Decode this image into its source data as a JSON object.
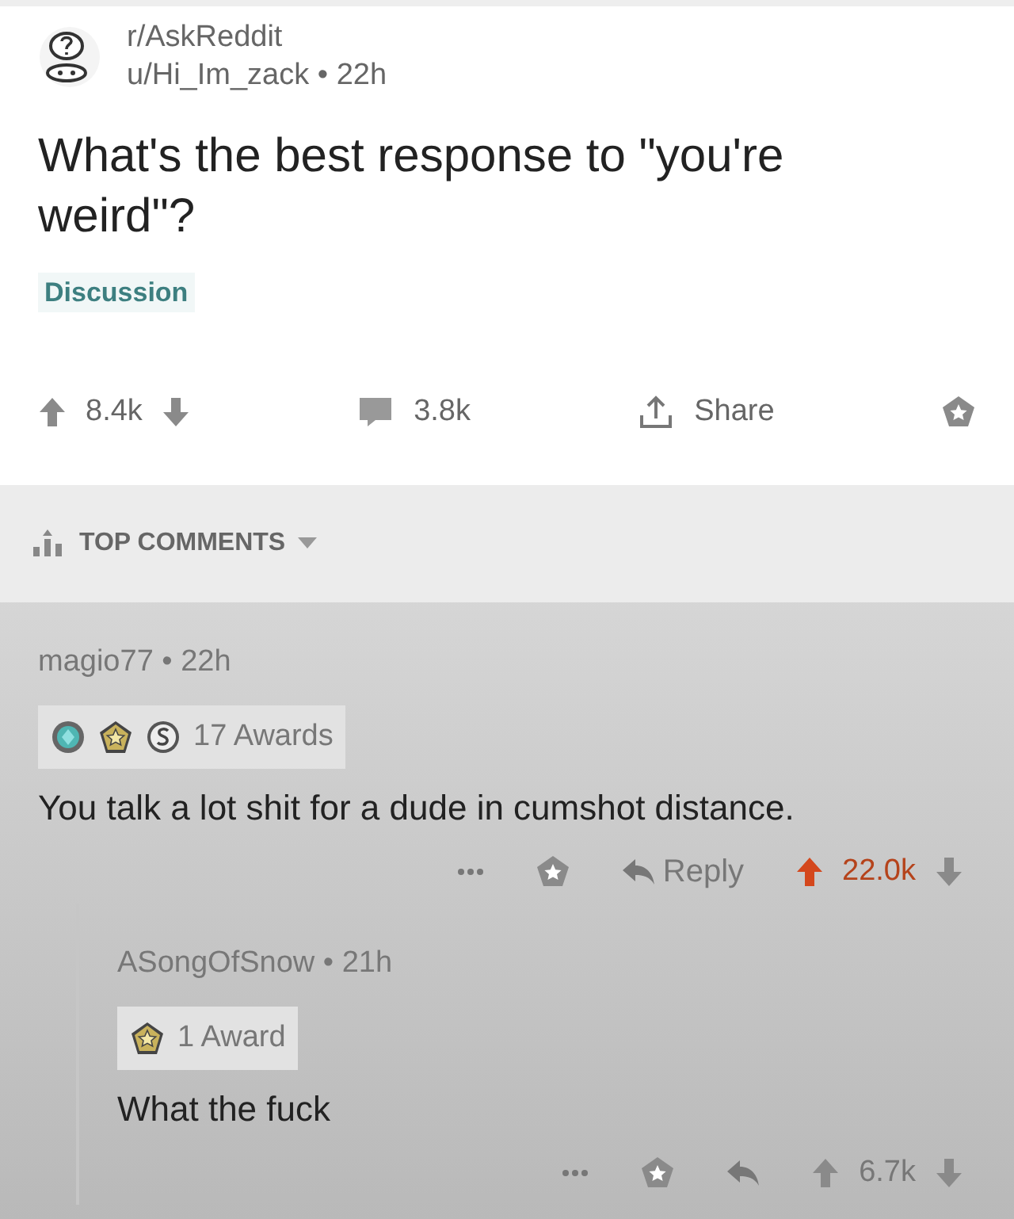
{
  "post": {
    "subreddit": "r/AskReddit",
    "author": "u/Hi_Im_zack",
    "separator": "•",
    "age": "22h",
    "title": "What's the best response to \"you're weird\"?",
    "flair": "Discussion",
    "score": "8.4k",
    "comments": "3.8k",
    "share": "Share"
  },
  "sort": {
    "label": "TOP COMMENTS"
  },
  "comments": [
    {
      "author": "magio77",
      "separator": "•",
      "age": "22h",
      "awards": [
        {
          "kind": "gem"
        },
        {
          "kind": "star"
        },
        {
          "kind": "silver"
        }
      ],
      "award_label": "17 Awards",
      "body": "You talk a lot shit for a dude in cumshot distance.",
      "reply_label": "Reply",
      "score": "22.0k",
      "upvoted": true,
      "children": [
        {
          "author": "ASongOfSnow",
          "separator": "•",
          "age": "21h",
          "awards": [
            {
              "kind": "star"
            }
          ],
          "award_label": "1 Award",
          "body": "What the fuck",
          "score": "6.7k",
          "upvoted": false
        }
      ]
    }
  ]
}
